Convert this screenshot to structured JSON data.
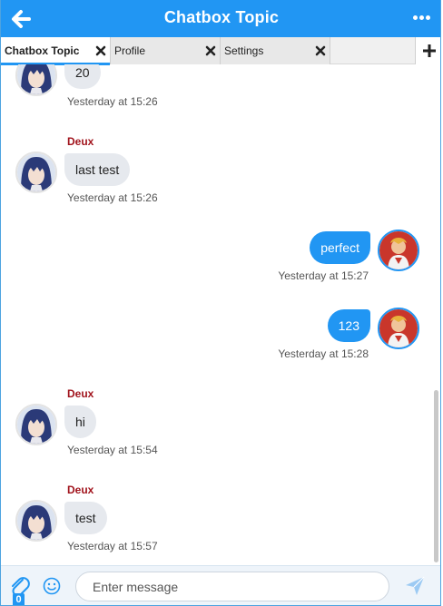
{
  "header": {
    "title": "Chatbox Topic",
    "back_icon": "arrow-left-icon",
    "more_icon": "more-dots-icon",
    "color": "#2196f3"
  },
  "tabs": [
    {
      "label": "Chatbox Topic",
      "active": true
    },
    {
      "label": "Profile",
      "active": false
    },
    {
      "label": "Settings",
      "active": false
    }
  ],
  "messages": [
    {
      "sender": "",
      "text": "20",
      "time": "Yesterday at 15:26",
      "side": "left"
    },
    {
      "sender": "Deux",
      "text": "last test",
      "time": "Yesterday at 15:26",
      "side": "left"
    },
    {
      "sender": "",
      "text": "perfect",
      "time": "Yesterday at 15:27",
      "side": "right"
    },
    {
      "sender": "",
      "text": "123",
      "time": "Yesterday at 15:28",
      "side": "right"
    },
    {
      "sender": "Deux",
      "text": "hi",
      "time": "Yesterday at 15:54",
      "side": "left"
    },
    {
      "sender": "Deux",
      "text": "test",
      "time": "Yesterday at 15:57",
      "side": "left"
    }
  ],
  "footer": {
    "attach_count": "0",
    "placeholder": "Enter message",
    "value": ""
  },
  "colors": {
    "accent": "#2196f3",
    "sender_name": "#a1131c",
    "incoming_bubble": "#e6e9ee"
  }
}
